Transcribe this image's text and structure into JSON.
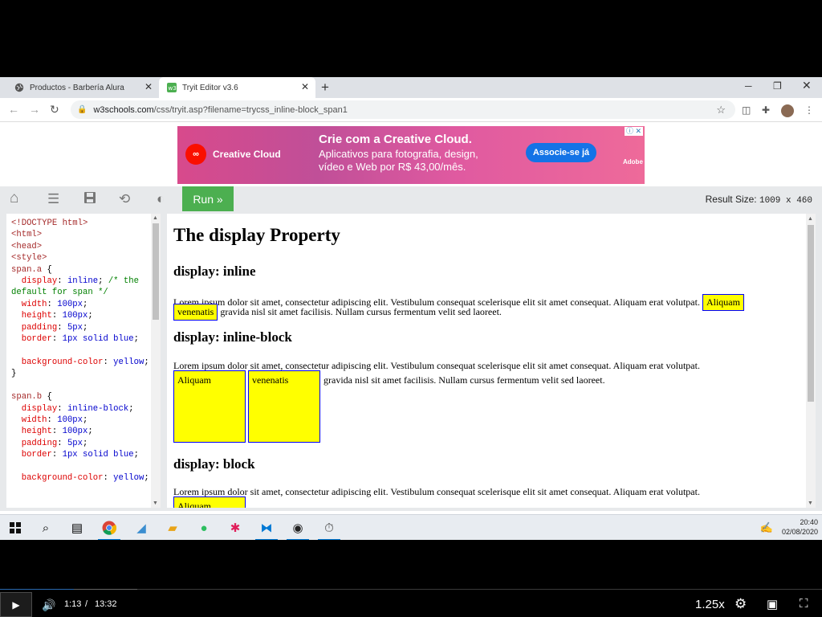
{
  "browser": {
    "tabs": [
      {
        "title": "Productos - Barbería Alura",
        "active": false,
        "icon": "globe-icon"
      },
      {
        "title": "Tryit Editor v3.6",
        "active": true,
        "icon": "w3schools-icon"
      }
    ],
    "url_host": "w3schools.com",
    "url_path": "/css/tryit.asp?filename=trycss_inline-block_span1"
  },
  "ad": {
    "brand": "Creative Cloud",
    "headline": "Crie com a Creative Cloud.",
    "body": "Aplicativos para fotografia, design, vídeo e Web por R$ 43,00/mês.",
    "cta": "Associe-se já",
    "adobe_label": "Adobe"
  },
  "toolbar": {
    "run_label": "Run »",
    "result_size_label": "Result Size:",
    "result_size_value": "1009 x 460"
  },
  "result": {
    "h1": "The display Property",
    "h2_inline": "display: inline",
    "h2_inline_block": "display: inline-block",
    "h2_block": "display: block",
    "lorem": "Lorem ipsum dolor sit amet, consectetur adipiscing elit. Vestibulum consequat scelerisque elit sit amet consequat. Aliquam erat volutpat.",
    "span1": "Aliquam",
    "span2": "venenatis",
    "after": "gravida nisl sit amet facilisis. Nullam cursus fermentum velit sed laoreet."
  },
  "taskbar": {
    "time": "20:40",
    "date": "02/08/2020"
  },
  "player": {
    "current_time": "1:13",
    "separator": "/",
    "duration": "13:32",
    "speed": "1.25x",
    "progress_fraction": 0.09,
    "buffered_fraction": 0.167
  }
}
